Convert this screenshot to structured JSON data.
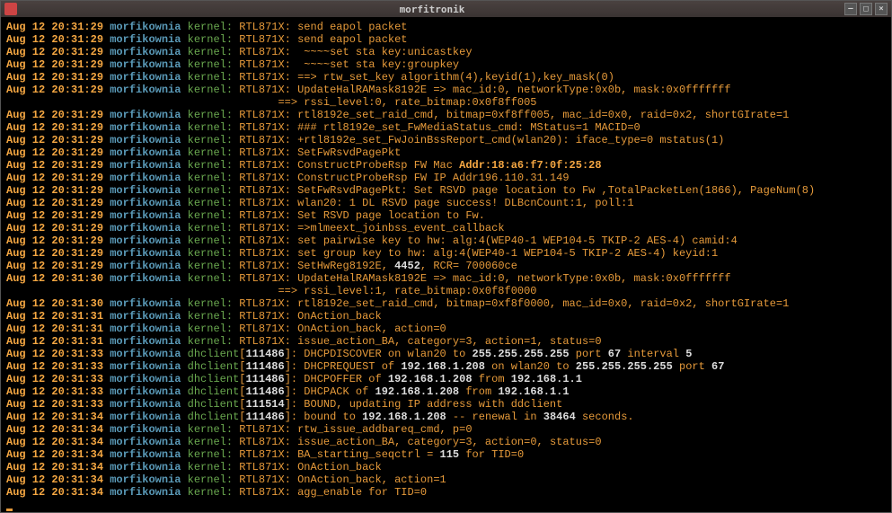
{
  "window": {
    "title": "morfitronik"
  },
  "lines": [
    [
      [
        "bo",
        "Aug 12 20:31:29"
      ],
      [
        "sp",
        " "
      ],
      [
        "cy",
        "morfikownia"
      ],
      [
        "sp",
        " "
      ],
      [
        "gr",
        "kernel:"
      ],
      [
        "sp",
        " "
      ],
      [
        "or",
        "RTL871X: send eapol packet"
      ]
    ],
    [
      [
        "bo",
        "Aug 12 20:31:29"
      ],
      [
        "sp",
        " "
      ],
      [
        "cy",
        "morfikownia"
      ],
      [
        "sp",
        " "
      ],
      [
        "gr",
        "kernel:"
      ],
      [
        "sp",
        " "
      ],
      [
        "or",
        "RTL871X: send eapol packet"
      ]
    ],
    [
      [
        "bo",
        "Aug 12 20:31:29"
      ],
      [
        "sp",
        " "
      ],
      [
        "cy",
        "morfikownia"
      ],
      [
        "sp",
        " "
      ],
      [
        "gr",
        "kernel:"
      ],
      [
        "sp",
        " "
      ],
      [
        "or",
        "RTL871X:  ~~~~set sta key:unicastkey"
      ]
    ],
    [
      [
        "bo",
        "Aug 12 20:31:29"
      ],
      [
        "sp",
        " "
      ],
      [
        "cy",
        "morfikownia"
      ],
      [
        "sp",
        " "
      ],
      [
        "gr",
        "kernel:"
      ],
      [
        "sp",
        " "
      ],
      [
        "or",
        "RTL871X:  ~~~~set sta key:groupkey"
      ]
    ],
    [
      [
        "bo",
        "Aug 12 20:31:29"
      ],
      [
        "sp",
        " "
      ],
      [
        "cy",
        "morfikownia"
      ],
      [
        "sp",
        " "
      ],
      [
        "gr",
        "kernel:"
      ],
      [
        "sp",
        " "
      ],
      [
        "or",
        "RTL871X: ==> rtw_set_key algorithm(4),keyid(1),key_mask(0)"
      ]
    ],
    [
      [
        "bo",
        "Aug 12 20:31:29"
      ],
      [
        "sp",
        " "
      ],
      [
        "cy",
        "morfikownia"
      ],
      [
        "sp",
        " "
      ],
      [
        "gr",
        "kernel:"
      ],
      [
        "sp",
        " "
      ],
      [
        "or",
        "RTL871X: UpdateHalRAMask8192E => mac_id:0, networkType:0x0b, mask:0x0fffffff"
      ]
    ],
    [
      [
        "or",
        "                                          ==> rssi_level:0, rate_bitmap:0x0f8ff005"
      ]
    ],
    [
      [
        "bo",
        "Aug 12 20:31:29"
      ],
      [
        "sp",
        " "
      ],
      [
        "cy",
        "morfikownia"
      ],
      [
        "sp",
        " "
      ],
      [
        "gr",
        "kernel:"
      ],
      [
        "sp",
        " "
      ],
      [
        "or",
        "RTL871X: rtl8192e_set_raid_cmd, bitmap=0xf8ff005, mac_id=0x0, raid=0x2, shortGIrate=1"
      ]
    ],
    [
      [
        "bo",
        "Aug 12 20:31:29"
      ],
      [
        "sp",
        " "
      ],
      [
        "cy",
        "morfikownia"
      ],
      [
        "sp",
        " "
      ],
      [
        "gr",
        "kernel:"
      ],
      [
        "sp",
        " "
      ],
      [
        "or",
        "RTL871X: ### rtl8192e_set_FwMediaStatus_cmd: MStatus=1 MACID=0"
      ]
    ],
    [
      [
        "bo",
        "Aug 12 20:31:29"
      ],
      [
        "sp",
        " "
      ],
      [
        "cy",
        "morfikownia"
      ],
      [
        "sp",
        " "
      ],
      [
        "gr",
        "kernel:"
      ],
      [
        "sp",
        " "
      ],
      [
        "or",
        "RTL871X: +rtl8192e_set_FwJoinBssReport_cmd(wlan20): iface_type=0 mstatus(1)"
      ]
    ],
    [
      [
        "bo",
        "Aug 12 20:31:29"
      ],
      [
        "sp",
        " "
      ],
      [
        "cy",
        "morfikownia"
      ],
      [
        "sp",
        " "
      ],
      [
        "gr",
        "kernel:"
      ],
      [
        "sp",
        " "
      ],
      [
        "or",
        "RTL871X: SetFwRsvdPagePkt"
      ]
    ],
    [
      [
        "bo",
        "Aug 12 20:31:29"
      ],
      [
        "sp",
        " "
      ],
      [
        "cy",
        "morfikownia"
      ],
      [
        "sp",
        " "
      ],
      [
        "gr",
        "kernel:"
      ],
      [
        "sp",
        " "
      ],
      [
        "or",
        "RTL871X: ConstructProbeRsp FW Mac "
      ],
      [
        "bo",
        "Addr:18:a6:f7:0f:25:28"
      ]
    ],
    [
      [
        "bo",
        "Aug 12 20:31:29"
      ],
      [
        "sp",
        " "
      ],
      [
        "cy",
        "morfikownia"
      ],
      [
        "sp",
        " "
      ],
      [
        "gr",
        "kernel:"
      ],
      [
        "sp",
        " "
      ],
      [
        "or",
        "RTL871X: ConstructProbeRsp FW IP Addr196.110.31.149"
      ]
    ],
    [
      [
        "bo",
        "Aug 12 20:31:29"
      ],
      [
        "sp",
        " "
      ],
      [
        "cy",
        "morfikownia"
      ],
      [
        "sp",
        " "
      ],
      [
        "gr",
        "kernel:"
      ],
      [
        "sp",
        " "
      ],
      [
        "or",
        "RTL871X: SetFwRsvdPagePkt: Set RSVD page location to Fw ,TotalPacketLen(1866), PageNum(8)"
      ]
    ],
    [
      [
        "bo",
        "Aug 12 20:31:29"
      ],
      [
        "sp",
        " "
      ],
      [
        "cy",
        "morfikownia"
      ],
      [
        "sp",
        " "
      ],
      [
        "gr",
        "kernel:"
      ],
      [
        "sp",
        " "
      ],
      [
        "or",
        "RTL871X: wlan20: 1 DL RSVD page success! DLBcnCount:1, poll:1"
      ]
    ],
    [
      [
        "bo",
        "Aug 12 20:31:29"
      ],
      [
        "sp",
        " "
      ],
      [
        "cy",
        "morfikownia"
      ],
      [
        "sp",
        " "
      ],
      [
        "gr",
        "kernel:"
      ],
      [
        "sp",
        " "
      ],
      [
        "or",
        "RTL871X: Set RSVD page location to Fw."
      ]
    ],
    [
      [
        "bo",
        "Aug 12 20:31:29"
      ],
      [
        "sp",
        " "
      ],
      [
        "cy",
        "morfikownia"
      ],
      [
        "sp",
        " "
      ],
      [
        "gr",
        "kernel:"
      ],
      [
        "sp",
        " "
      ],
      [
        "or",
        "RTL871X: =>mlmeext_joinbss_event_callback"
      ]
    ],
    [
      [
        "bo",
        "Aug 12 20:31:29"
      ],
      [
        "sp",
        " "
      ],
      [
        "cy",
        "morfikownia"
      ],
      [
        "sp",
        " "
      ],
      [
        "gr",
        "kernel:"
      ],
      [
        "sp",
        " "
      ],
      [
        "or",
        "RTL871X: set pairwise key to hw: alg:4(WEP40-1 WEP104-5 TKIP-2 AES-4) camid:4"
      ]
    ],
    [
      [
        "bo",
        "Aug 12 20:31:29"
      ],
      [
        "sp",
        " "
      ],
      [
        "cy",
        "morfikownia"
      ],
      [
        "sp",
        " "
      ],
      [
        "gr",
        "kernel:"
      ],
      [
        "sp",
        " "
      ],
      [
        "or",
        "RTL871X: set group key to hw: alg:4(WEP40-1 WEP104-5 TKIP-2 AES-4) keyid:1"
      ]
    ],
    [
      [
        "bo",
        "Aug 12 20:31:29"
      ],
      [
        "sp",
        " "
      ],
      [
        "cy",
        "morfikownia"
      ],
      [
        "sp",
        " "
      ],
      [
        "gr",
        "kernel:"
      ],
      [
        "sp",
        " "
      ],
      [
        "or",
        "RTL871X: SetHwReg8192E, "
      ],
      [
        "wh",
        "4452"
      ],
      [
        "or",
        ", RCR= 700060ce"
      ]
    ],
    [
      [
        "bo",
        "Aug 12 20:31:30"
      ],
      [
        "sp",
        " "
      ],
      [
        "cy",
        "morfikownia"
      ],
      [
        "sp",
        " "
      ],
      [
        "gr",
        "kernel:"
      ],
      [
        "sp",
        " "
      ],
      [
        "or",
        "RTL871X: UpdateHalRAMask8192E => mac_id:0, networkType:0x0b, mask:0x0fffffff"
      ]
    ],
    [
      [
        "or",
        "                                          ==> rssi_level:1, rate_bitmap:0x0f8f0000"
      ]
    ],
    [
      [
        "bo",
        "Aug 12 20:31:30"
      ],
      [
        "sp",
        " "
      ],
      [
        "cy",
        "morfikownia"
      ],
      [
        "sp",
        " "
      ],
      [
        "gr",
        "kernel:"
      ],
      [
        "sp",
        " "
      ],
      [
        "or",
        "RTL871X: rtl8192e_set_raid_cmd, bitmap=0xf8f0000, mac_id=0x0, raid=0x2, shortGIrate=1"
      ]
    ],
    [
      [
        "bo",
        "Aug 12 20:31:31"
      ],
      [
        "sp",
        " "
      ],
      [
        "cy",
        "morfikownia"
      ],
      [
        "sp",
        " "
      ],
      [
        "gr",
        "kernel:"
      ],
      [
        "sp",
        " "
      ],
      [
        "or",
        "RTL871X: OnAction_back"
      ]
    ],
    [
      [
        "bo",
        "Aug 12 20:31:31"
      ],
      [
        "sp",
        " "
      ],
      [
        "cy",
        "morfikownia"
      ],
      [
        "sp",
        " "
      ],
      [
        "gr",
        "kernel:"
      ],
      [
        "sp",
        " "
      ],
      [
        "or",
        "RTL871X: OnAction_back, action=0"
      ]
    ],
    [
      [
        "bo",
        "Aug 12 20:31:31"
      ],
      [
        "sp",
        " "
      ],
      [
        "cy",
        "morfikownia"
      ],
      [
        "sp",
        " "
      ],
      [
        "gr",
        "kernel:"
      ],
      [
        "sp",
        " "
      ],
      [
        "or",
        "RTL871X: issue_action_BA, category=3, action=1, status=0"
      ]
    ],
    [
      [
        "bo",
        "Aug 12 20:31:33"
      ],
      [
        "sp",
        " "
      ],
      [
        "cy",
        "morfikownia"
      ],
      [
        "sp",
        " "
      ],
      [
        "gr",
        "dhclient"
      ],
      [
        "or",
        "["
      ],
      [
        "wh",
        "111486"
      ],
      [
        "or",
        "]: DHCPDISCOVER on wlan20 to "
      ],
      [
        "wh",
        "255.255.255.255"
      ],
      [
        "or",
        " port "
      ],
      [
        "wh",
        "67"
      ],
      [
        "or",
        " interval "
      ],
      [
        "wh",
        "5"
      ]
    ],
    [
      [
        "bo",
        "Aug 12 20:31:33"
      ],
      [
        "sp",
        " "
      ],
      [
        "cy",
        "morfikownia"
      ],
      [
        "sp",
        " "
      ],
      [
        "gr",
        "dhclient"
      ],
      [
        "or",
        "["
      ],
      [
        "wh",
        "111486"
      ],
      [
        "or",
        "]: DHCPREQUEST of "
      ],
      [
        "wh",
        "192.168.1.208"
      ],
      [
        "or",
        " on wlan20 to "
      ],
      [
        "wh",
        "255.255.255.255"
      ],
      [
        "or",
        " port "
      ],
      [
        "wh",
        "67"
      ]
    ],
    [
      [
        "bo",
        "Aug 12 20:31:33"
      ],
      [
        "sp",
        " "
      ],
      [
        "cy",
        "morfikownia"
      ],
      [
        "sp",
        " "
      ],
      [
        "gr",
        "dhclient"
      ],
      [
        "or",
        "["
      ],
      [
        "wh",
        "111486"
      ],
      [
        "or",
        "]: DHCPOFFER of "
      ],
      [
        "wh",
        "192.168.1.208"
      ],
      [
        "or",
        " from "
      ],
      [
        "wh",
        "192.168.1.1"
      ]
    ],
    [
      [
        "bo",
        "Aug 12 20:31:33"
      ],
      [
        "sp",
        " "
      ],
      [
        "cy",
        "morfikownia"
      ],
      [
        "sp",
        " "
      ],
      [
        "gr",
        "dhclient"
      ],
      [
        "or",
        "["
      ],
      [
        "wh",
        "111486"
      ],
      [
        "or",
        "]: DHCPACK of "
      ],
      [
        "wh",
        "192.168.1.208"
      ],
      [
        "or",
        " from "
      ],
      [
        "wh",
        "192.168.1.1"
      ]
    ],
    [
      [
        "bo",
        "Aug 12 20:31:33"
      ],
      [
        "sp",
        " "
      ],
      [
        "cy",
        "morfikownia"
      ],
      [
        "sp",
        " "
      ],
      [
        "gr",
        "dhclient"
      ],
      [
        "or",
        "["
      ],
      [
        "wh",
        "111514"
      ],
      [
        "or",
        "]: BOUND, updating IP address with ddclient"
      ]
    ],
    [
      [
        "bo",
        "Aug 12 20:31:34"
      ],
      [
        "sp",
        " "
      ],
      [
        "cy",
        "morfikownia"
      ],
      [
        "sp",
        " "
      ],
      [
        "gr",
        "dhclient"
      ],
      [
        "or",
        "["
      ],
      [
        "wh",
        "111486"
      ],
      [
        "or",
        "]: bound to "
      ],
      [
        "wh",
        "192.168.1.208"
      ],
      [
        "or",
        " -- renewal in "
      ],
      [
        "wh",
        "38464"
      ],
      [
        "or",
        " seconds."
      ]
    ],
    [
      [
        "bo",
        "Aug 12 20:31:34"
      ],
      [
        "sp",
        " "
      ],
      [
        "cy",
        "morfikownia"
      ],
      [
        "sp",
        " "
      ],
      [
        "gr",
        "kernel:"
      ],
      [
        "sp",
        " "
      ],
      [
        "or",
        "RTL871X: rtw_issue_addbareq_cmd, p=0"
      ]
    ],
    [
      [
        "bo",
        "Aug 12 20:31:34"
      ],
      [
        "sp",
        " "
      ],
      [
        "cy",
        "morfikownia"
      ],
      [
        "sp",
        " "
      ],
      [
        "gr",
        "kernel:"
      ],
      [
        "sp",
        " "
      ],
      [
        "or",
        "RTL871X: issue_action_BA, category=3, action=0, status=0"
      ]
    ],
    [
      [
        "bo",
        "Aug 12 20:31:34"
      ],
      [
        "sp",
        " "
      ],
      [
        "cy",
        "morfikownia"
      ],
      [
        "sp",
        " "
      ],
      [
        "gr",
        "kernel:"
      ],
      [
        "sp",
        " "
      ],
      [
        "or",
        "RTL871X: BA_starting_seqctrl = "
      ],
      [
        "wh",
        "115"
      ],
      [
        "or",
        " for TID=0"
      ]
    ],
    [
      [
        "bo",
        "Aug 12 20:31:34"
      ],
      [
        "sp",
        " "
      ],
      [
        "cy",
        "morfikownia"
      ],
      [
        "sp",
        " "
      ],
      [
        "gr",
        "kernel:"
      ],
      [
        "sp",
        " "
      ],
      [
        "or",
        "RTL871X: OnAction_back"
      ]
    ],
    [
      [
        "bo",
        "Aug 12 20:31:34"
      ],
      [
        "sp",
        " "
      ],
      [
        "cy",
        "morfikownia"
      ],
      [
        "sp",
        " "
      ],
      [
        "gr",
        "kernel:"
      ],
      [
        "sp",
        " "
      ],
      [
        "or",
        "RTL871X: OnAction_back, action=1"
      ]
    ],
    [
      [
        "bo",
        "Aug 12 20:31:34"
      ],
      [
        "sp",
        " "
      ],
      [
        "cy",
        "morfikownia"
      ],
      [
        "sp",
        " "
      ],
      [
        "gr",
        "kernel:"
      ],
      [
        "sp",
        " "
      ],
      [
        "or",
        "RTL871X: agg_enable for TID=0"
      ]
    ]
  ]
}
